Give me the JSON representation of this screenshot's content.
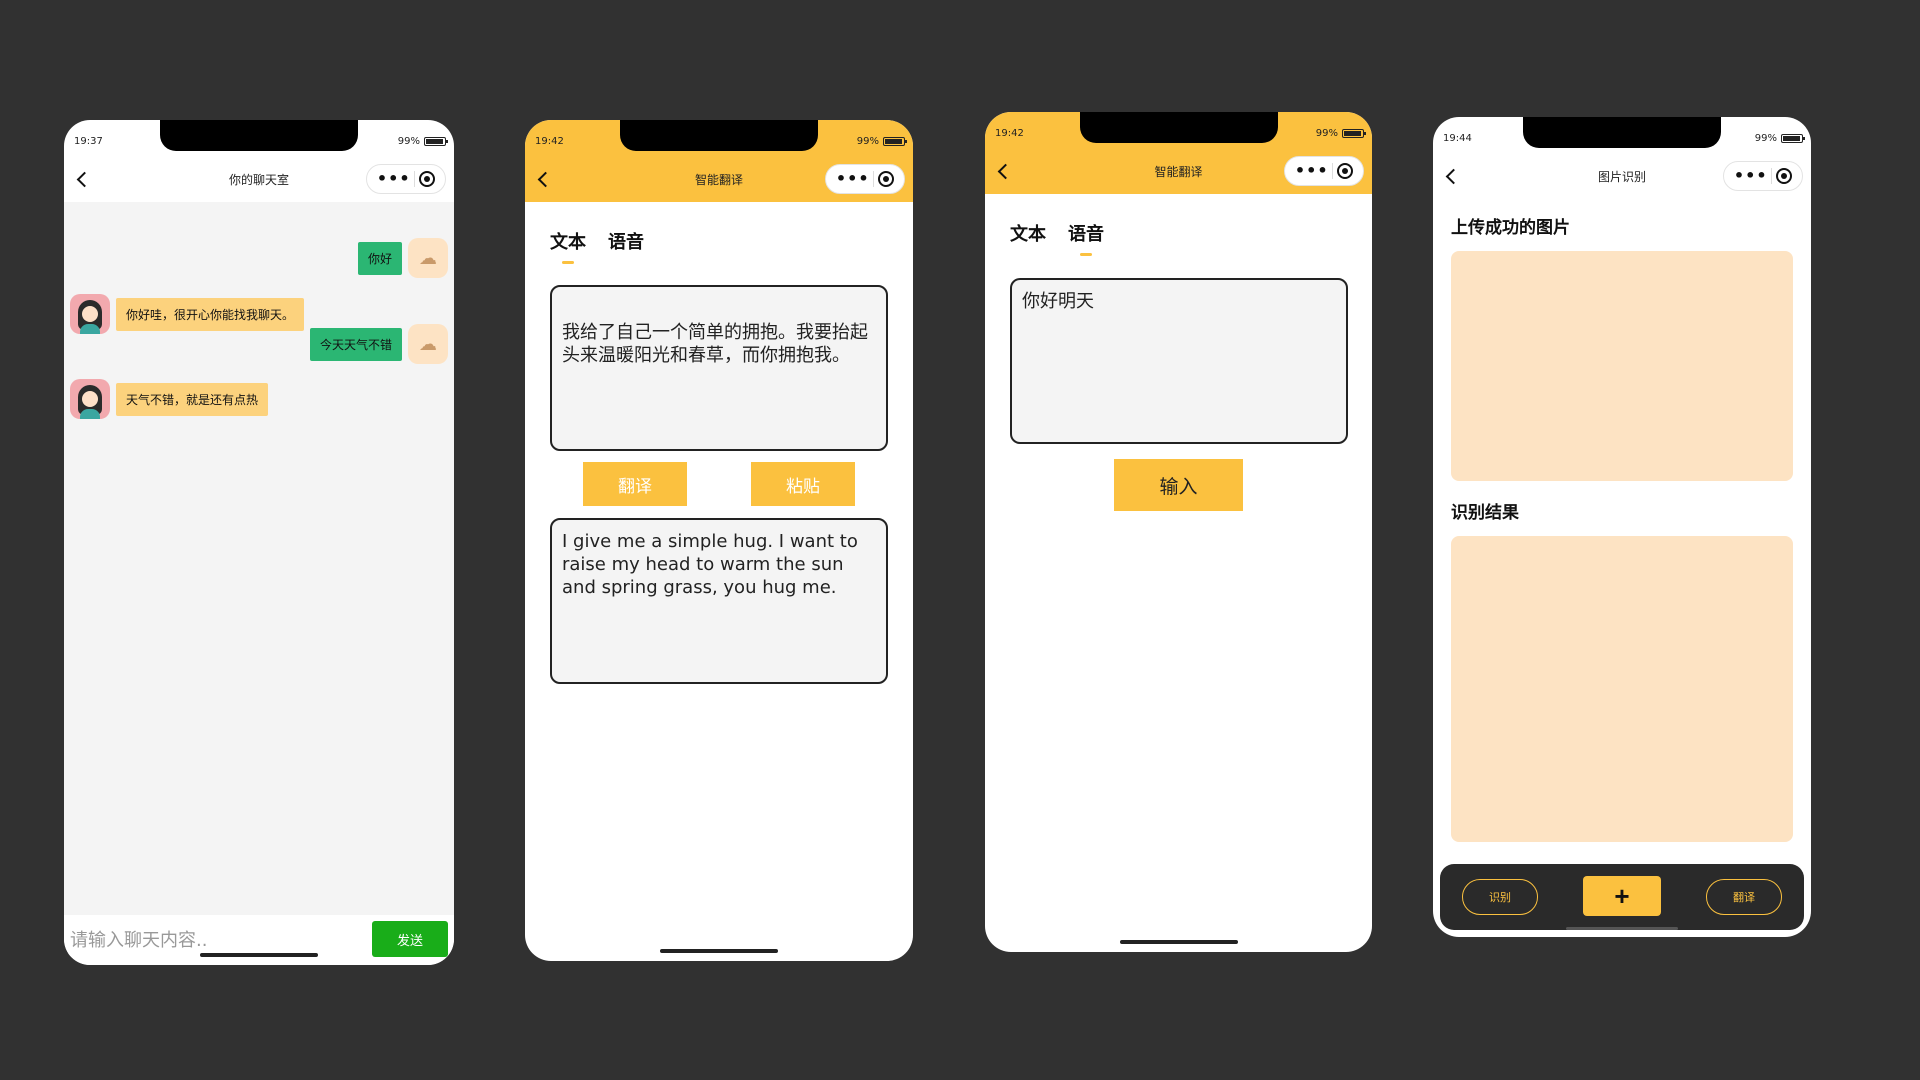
{
  "phone1": {
    "status_time": "19:37",
    "battery": "99%",
    "title": "你的聊天室",
    "messages": [
      {
        "side": "right",
        "text": "你好"
      },
      {
        "side": "left",
        "text": "你好哇，很开心你能找我聊天。"
      },
      {
        "side": "right",
        "text": "今天天气不错"
      },
      {
        "side": "left",
        "text": "天气不错，就是还有点热"
      }
    ],
    "input_placeholder": "请输入聊天内容..",
    "send_label": "发送"
  },
  "phone2": {
    "status_time": "19:42",
    "battery": "99%",
    "title": "智能翻译",
    "tabs": [
      "文本",
      "语音"
    ],
    "active_tab": "文本",
    "source_text": "我给了自己一个简单的拥抱。我要抬起头来温暖阳光和春草，而你拥抱我。",
    "translate_label": "翻译",
    "paste_label": "粘贴",
    "result_text": "I give me a simple hug. I want to raise my head to warm the sun and spring grass, you hug me."
  },
  "phone3": {
    "status_time": "19:42",
    "battery": "99%",
    "title": "智能翻译",
    "tabs": [
      "文本",
      "语音"
    ],
    "active_tab": "语音",
    "voice_text": "你好明天",
    "input_label": "输入"
  },
  "phone4": {
    "status_time": "19:44",
    "battery": "99%",
    "title": "图片识别",
    "uploaded_title": "上传成功的图片",
    "result_title": "识别结果",
    "recognize_label": "识别",
    "add_label": "+",
    "translate_label": "翻译"
  },
  "colors": {
    "background": "#313131",
    "accent_yellow": "#fbc13f",
    "chat_green": "#2bb673",
    "send_green": "#19ad19",
    "bubble_yellow": "#fcd27d",
    "peach": "#fde3c3"
  }
}
